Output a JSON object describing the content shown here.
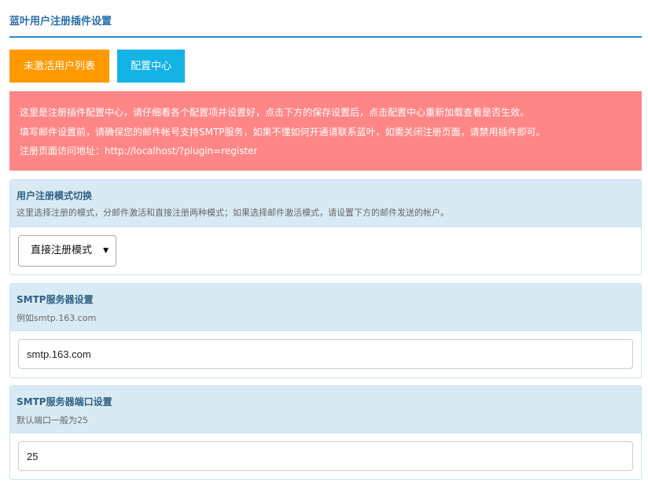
{
  "header": {
    "title": "蓝叶用户注册插件设置"
  },
  "toolbar": {
    "inactive_users_label": "未激活用户列表",
    "config_center_label": "配置中心"
  },
  "notice": {
    "lines": [
      "这里是注册插件配置中心，请仔细看各个配置项并设置好，点击下方的保存设置后，点击配置中心重新加载查看是否生效。",
      "填写邮件设置前，请确保您的邮件帐号支持SMTP服务，如果不懂如何开通请联系蓝叶，如需关闭注册页面，请禁用插件即可。",
      "注册页面访问地址：http://localhost/?plugin=register"
    ]
  },
  "sections": {
    "register_mode": {
      "title": "用户注册模式切换",
      "description": "这里选择注册的模式，分邮件激活和直接注册两种模式；如果选择邮件激活模式，请设置下方的邮件发送的帐户。",
      "selected": "直接注册模式"
    },
    "smtp_server": {
      "title": "SMTP服务器设置",
      "description": "例如smtp.163.com",
      "value": "smtp.163.com"
    },
    "smtp_port": {
      "title": "SMTP服务器端口设置",
      "description": "默认端口一般为25",
      "value": "25"
    }
  },
  "colors": {
    "accent": "#2a8ac9",
    "orange_button": "#ff9900",
    "blue_button": "#13b3e6",
    "alert_bg": "#ff8686",
    "panel_head_bg": "#d8ebf4"
  }
}
